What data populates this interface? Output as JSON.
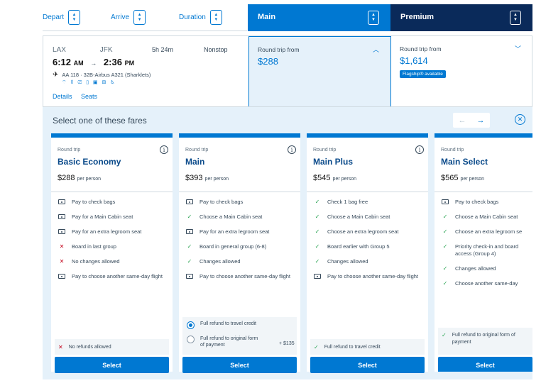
{
  "sort": {
    "depart": "Depart",
    "arrive": "Arrive",
    "duration": "Duration"
  },
  "cabins": {
    "main_label": "Main",
    "premium_label": "Premium"
  },
  "flight": {
    "origin": "LAX",
    "destination": "JFK",
    "depart_time": "6:12",
    "depart_ampm": "AM",
    "arrive_time": "2:36",
    "arrive_ampm": "PM",
    "duration": "5h 24m",
    "stops": "Nonstop",
    "flight_info": "AA 118 · 32B-Airbus A321 (Sharklets)",
    "amenities": "⌔ ⌷ ⎚ ▯ ▣ ⊞ ♿",
    "details_link": "Details",
    "seats_link": "Seats",
    "main_from_label": "Round trip from",
    "main_price": "$288",
    "premium_from_label": "Round trip from",
    "premium_price": "$1,614",
    "flagship_badge": "Flagship® available"
  },
  "panel": {
    "title": "Select one of these fares"
  },
  "fares": [
    {
      "trip": "Round trip",
      "name": "Basic Economy",
      "price": "$288",
      "per": "per person",
      "features": [
        {
          "type": "fee",
          "text": "Pay to check bags"
        },
        {
          "type": "fee",
          "text": "Pay for a Main Cabin seat"
        },
        {
          "type": "fee",
          "text": "Pay for an extra legroom seat"
        },
        {
          "type": "cross",
          "text": "Board in last group"
        },
        {
          "type": "cross",
          "text": "No changes allowed"
        },
        {
          "type": "fee",
          "text": "Pay to choose another same-day flight"
        }
      ],
      "refund": "No refunds allowed",
      "select": "Select"
    },
    {
      "trip": "Round trip",
      "name": "Main",
      "price": "$393",
      "per": "per person",
      "features": [
        {
          "type": "fee",
          "text": "Pay to check bags"
        },
        {
          "type": "check",
          "text": "Choose a Main Cabin seat"
        },
        {
          "type": "fee",
          "text": "Pay for an extra legroom seat"
        },
        {
          "type": "check",
          "text": "Board in general group (6-8)"
        },
        {
          "type": "check",
          "text": "Changes allowed"
        },
        {
          "type": "fee",
          "text": "Pay to choose another same-day flight"
        }
      ],
      "refund_option1": "Full refund to travel credit",
      "refund_option2": "Full refund to original form of payment",
      "refund_option2_fee": "+ $135",
      "select": "Select"
    },
    {
      "trip": "Round trip",
      "name": "Main Plus",
      "price": "$545",
      "per": "per person",
      "features": [
        {
          "type": "check",
          "text": "Check 1 bag free"
        },
        {
          "type": "check",
          "text": "Choose a Main Cabin seat"
        },
        {
          "type": "check",
          "text": "Choose an extra legroom seat"
        },
        {
          "type": "check",
          "text": "Board earlier with Group 5"
        },
        {
          "type": "check",
          "text": "Changes allowed"
        },
        {
          "type": "fee",
          "text": "Pay to choose another same-day flight"
        }
      ],
      "refund": "Full refund to travel credit",
      "select": "Select"
    },
    {
      "trip": "Round trip",
      "name": "Main Select",
      "price": "$565",
      "per": "per person",
      "features": [
        {
          "type": "fee",
          "text": "Pay to check bags"
        },
        {
          "type": "check",
          "text": "Choose a Main Cabin seat"
        },
        {
          "type": "check",
          "text": "Choose an extra legroom se"
        },
        {
          "type": "check",
          "text": "Priority check-in and board access (Group 4)"
        },
        {
          "type": "check",
          "text": "Changes allowed"
        },
        {
          "type": "check",
          "text": "Choose another same-day"
        }
      ],
      "refund": "Full refund to original form of payment",
      "select": "Select"
    }
  ]
}
